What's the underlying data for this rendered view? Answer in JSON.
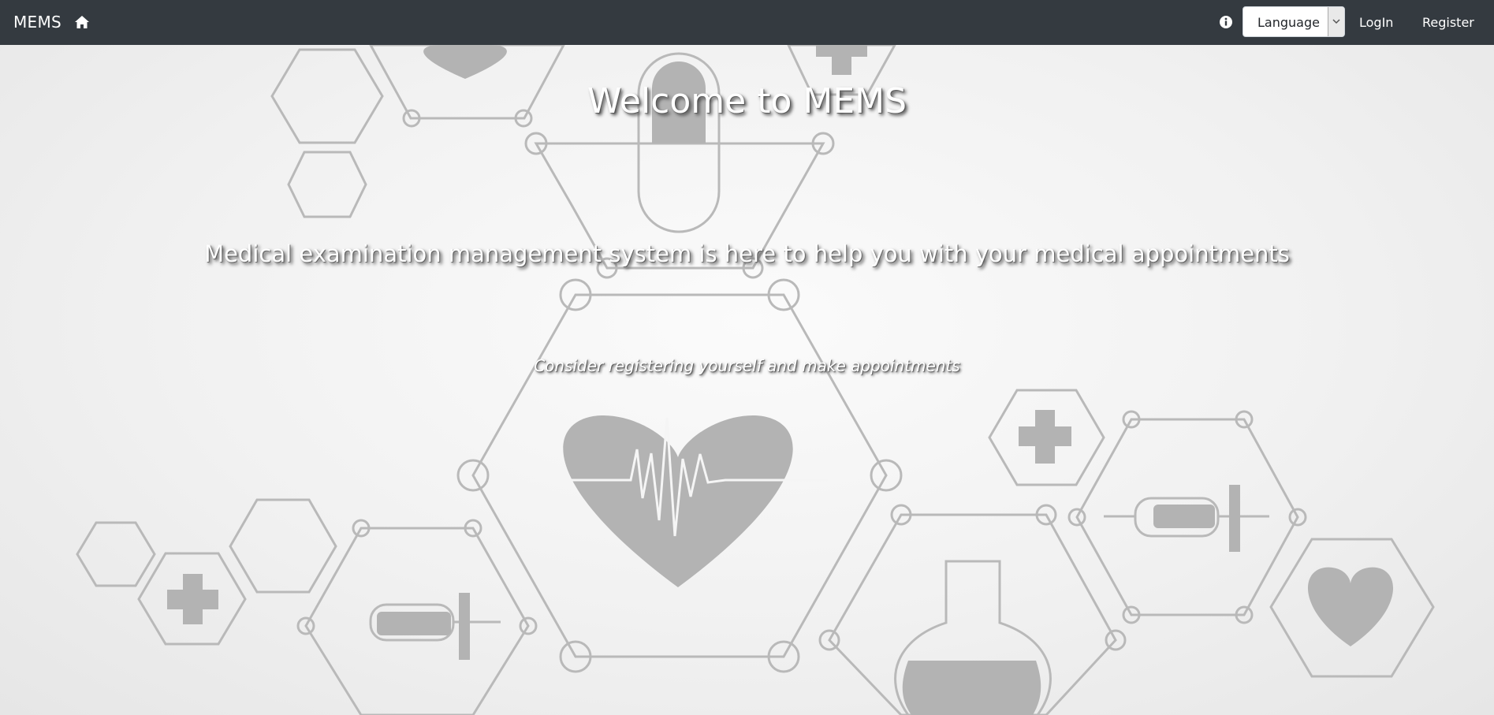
{
  "navbar": {
    "brand": "MEMS",
    "icons": {
      "home": "home-icon",
      "info": "info-icon"
    },
    "language_select": {
      "selected": "Language"
    },
    "login_label": "LogIn",
    "register_label": "Register",
    "background_color": "#343a40"
  },
  "hero": {
    "title": "Welcome to MEMS",
    "subtitle": "Medical examination management system is here to help you with your medical appointments",
    "cta": "Consider registering yourself and make appointments"
  }
}
